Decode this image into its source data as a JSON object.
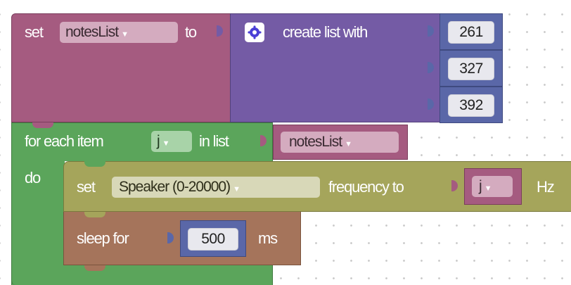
{
  "blocks": {
    "set_var": {
      "keyword": "set",
      "variable": "notesList",
      "to_label": "to"
    },
    "create_list": {
      "label": "create list with",
      "items": [
        "261",
        "327",
        "392"
      ]
    },
    "for_each": {
      "keyword": "for each item",
      "variable": "j",
      "in_list": "in list",
      "list_var": "notesList",
      "do_label": "do"
    },
    "set_speaker": {
      "keyword": "set",
      "device": "Speaker (0-20000)",
      "property": "frequency to",
      "value_var": "j",
      "unit": "Hz"
    },
    "sleep": {
      "label": "sleep for",
      "value": "500",
      "unit": "ms"
    }
  },
  "colors": {
    "variables": "#a55b80",
    "lists": "#745ba5",
    "loops": "#5ba55b",
    "actuator": "#a5a55b",
    "time": "#a5745b"
  }
}
